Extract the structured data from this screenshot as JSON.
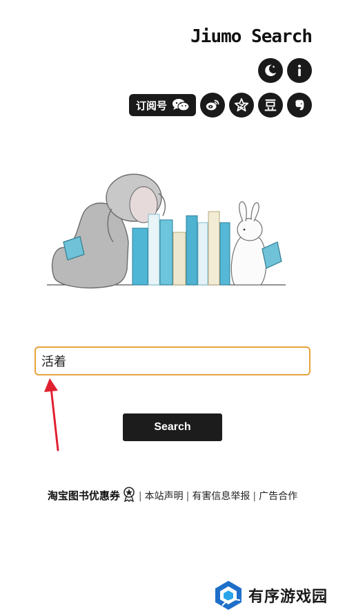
{
  "header": {
    "brand": "Jiumo Search",
    "subscribe_label": "订阅号"
  },
  "icons": {
    "row1": [
      "moon-icon",
      "info-icon"
    ],
    "row2": [
      "wechat-icon",
      "weibo-icon",
      "star-icon",
      "douban-icon",
      "evernote-icon"
    ]
  },
  "search": {
    "value": "活着",
    "button_label": "Search"
  },
  "footer": {
    "coupon_label": "淘宝图书优惠券",
    "links": [
      "本站声明",
      "有害信息举报",
      "广告合作"
    ]
  },
  "watermark": {
    "text": "有序游戏园"
  },
  "colors": {
    "input_border": "#e6a23c",
    "arrow": "#e02030",
    "button_bg": "#1c1c1c",
    "icon_bg": "#1a1a1a"
  }
}
